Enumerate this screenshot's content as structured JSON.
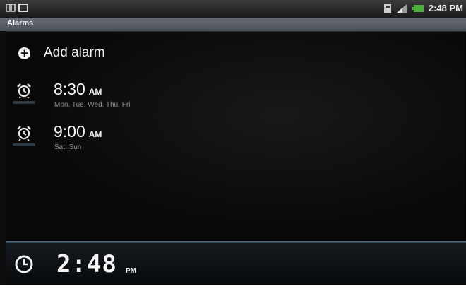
{
  "status_bar": {
    "time": "2:48 PM",
    "icons": [
      "usb-debug-icon",
      "screen-icon",
      "storage-icon",
      "signal-icon",
      "battery-icon"
    ]
  },
  "title_bar": {
    "title": "Alarms"
  },
  "add_alarm": {
    "label": "Add alarm",
    "icon": "add-circle-icon"
  },
  "alarms": [
    {
      "time": "8:30",
      "ampm": "AM",
      "days": "Mon, Tue, Wed, Thu, Fri",
      "enabled": false
    },
    {
      "time": "9:00",
      "ampm": "AM",
      "days": "Sat, Sun",
      "enabled": false
    }
  ],
  "clock": {
    "time": "2:48",
    "ampm": "PM",
    "icon": "clock-icon"
  },
  "colors": {
    "background": "#050505",
    "title_bar": "#5a5f68",
    "divider": "#4a5f70",
    "accent_text": "#f4f4f4",
    "secondary_text": "#8c8c8c"
  }
}
